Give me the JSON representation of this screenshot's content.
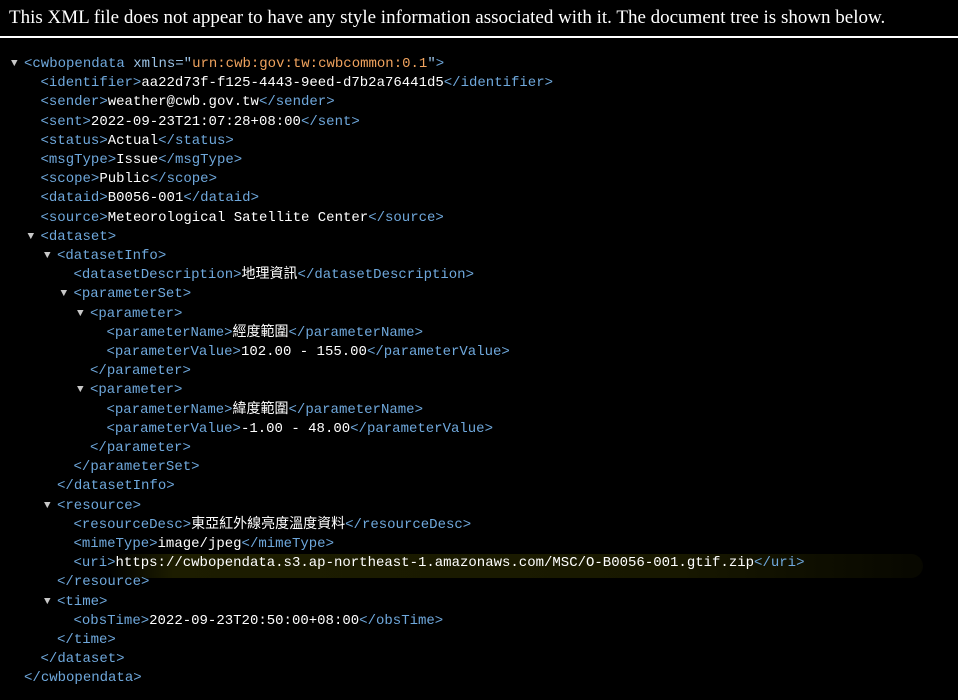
{
  "banner": {
    "text": "This XML file does not appear to have any style information associated with it. The document tree is shown below."
  },
  "colors": {
    "tag": "#6fa8dc",
    "attr_name": "#9cc3e6",
    "attr_value": "#f0a35e",
    "text": "#ffffff",
    "background": "#000000"
  },
  "toggle_icon": "triangle-down-icon",
  "lines": [
    {
      "depth": 0,
      "toggle": true,
      "tag": "cwbopendata",
      "attr": "xmlns",
      "attr_value": "urn:cwb:gov:tw:cwbcommon:0.1",
      "type": "open"
    },
    {
      "depth": 1,
      "tag": "identifier",
      "text": "aa22d73f-f125-4443-9eed-d7b2a76441d5",
      "type": "leaf"
    },
    {
      "depth": 1,
      "tag": "sender",
      "text": "weather@cwb.gov.tw",
      "type": "leaf"
    },
    {
      "depth": 1,
      "tag": "sent",
      "text": "2022-09-23T21:07:28+08:00",
      "type": "leaf"
    },
    {
      "depth": 1,
      "tag": "status",
      "text": "Actual",
      "type": "leaf"
    },
    {
      "depth": 1,
      "tag": "msgType",
      "text": "Issue",
      "type": "leaf"
    },
    {
      "depth": 1,
      "tag": "scope",
      "text": "Public",
      "type": "leaf"
    },
    {
      "depth": 1,
      "tag": "dataid",
      "text": "B0056-001",
      "type": "leaf"
    },
    {
      "depth": 1,
      "tag": "source",
      "text": "Meteorological Satellite Center",
      "type": "leaf"
    },
    {
      "depth": 1,
      "toggle": true,
      "tag": "dataset",
      "type": "open"
    },
    {
      "depth": 2,
      "toggle": true,
      "tag": "datasetInfo",
      "type": "open"
    },
    {
      "depth": 3,
      "tag": "datasetDescription",
      "text": "地理資訊",
      "type": "leaf"
    },
    {
      "depth": 3,
      "toggle": true,
      "tag": "parameterSet",
      "type": "open"
    },
    {
      "depth": 4,
      "toggle": true,
      "tag": "parameter",
      "type": "open"
    },
    {
      "depth": 5,
      "tag": "parameterName",
      "text": "經度範圍",
      "type": "leaf"
    },
    {
      "depth": 5,
      "tag": "parameterValue",
      "text": "102.00 - 155.00",
      "type": "leaf"
    },
    {
      "depth": 4,
      "tag": "parameter",
      "type": "close"
    },
    {
      "depth": 4,
      "toggle": true,
      "tag": "parameter",
      "type": "open"
    },
    {
      "depth": 5,
      "tag": "parameterName",
      "text": "緯度範圍",
      "type": "leaf"
    },
    {
      "depth": 5,
      "tag": "parameterValue",
      "text": "-1.00 - 48.00",
      "type": "leaf"
    },
    {
      "depth": 4,
      "tag": "parameter",
      "type": "close"
    },
    {
      "depth": 3,
      "tag": "parameterSet",
      "type": "close"
    },
    {
      "depth": 2,
      "tag": "datasetInfo",
      "type": "close"
    },
    {
      "depth": 2,
      "toggle": true,
      "tag": "resource",
      "type": "open"
    },
    {
      "depth": 3,
      "tag": "resourceDesc",
      "text": "東亞紅外線亮度溫度資料",
      "type": "leaf"
    },
    {
      "depth": 3,
      "tag": "mimeType",
      "text": "image/jpeg",
      "type": "leaf"
    },
    {
      "depth": 3,
      "tag": "uri",
      "text": "https://cwbopendata.s3.ap-northeast-1.amazonaws.com/MSC/O-B0056-001.gtif.zip",
      "type": "leaf",
      "highlight": true
    },
    {
      "depth": 2,
      "tag": "resource",
      "type": "close"
    },
    {
      "depth": 2,
      "toggle": true,
      "tag": "time",
      "type": "open"
    },
    {
      "depth": 3,
      "tag": "obsTime",
      "text": "2022-09-23T20:50:00+08:00",
      "type": "leaf"
    },
    {
      "depth": 2,
      "tag": "time",
      "type": "close"
    },
    {
      "depth": 1,
      "tag": "dataset",
      "type": "close"
    },
    {
      "depth": 0,
      "tag": "cwbopendata",
      "type": "close"
    }
  ]
}
